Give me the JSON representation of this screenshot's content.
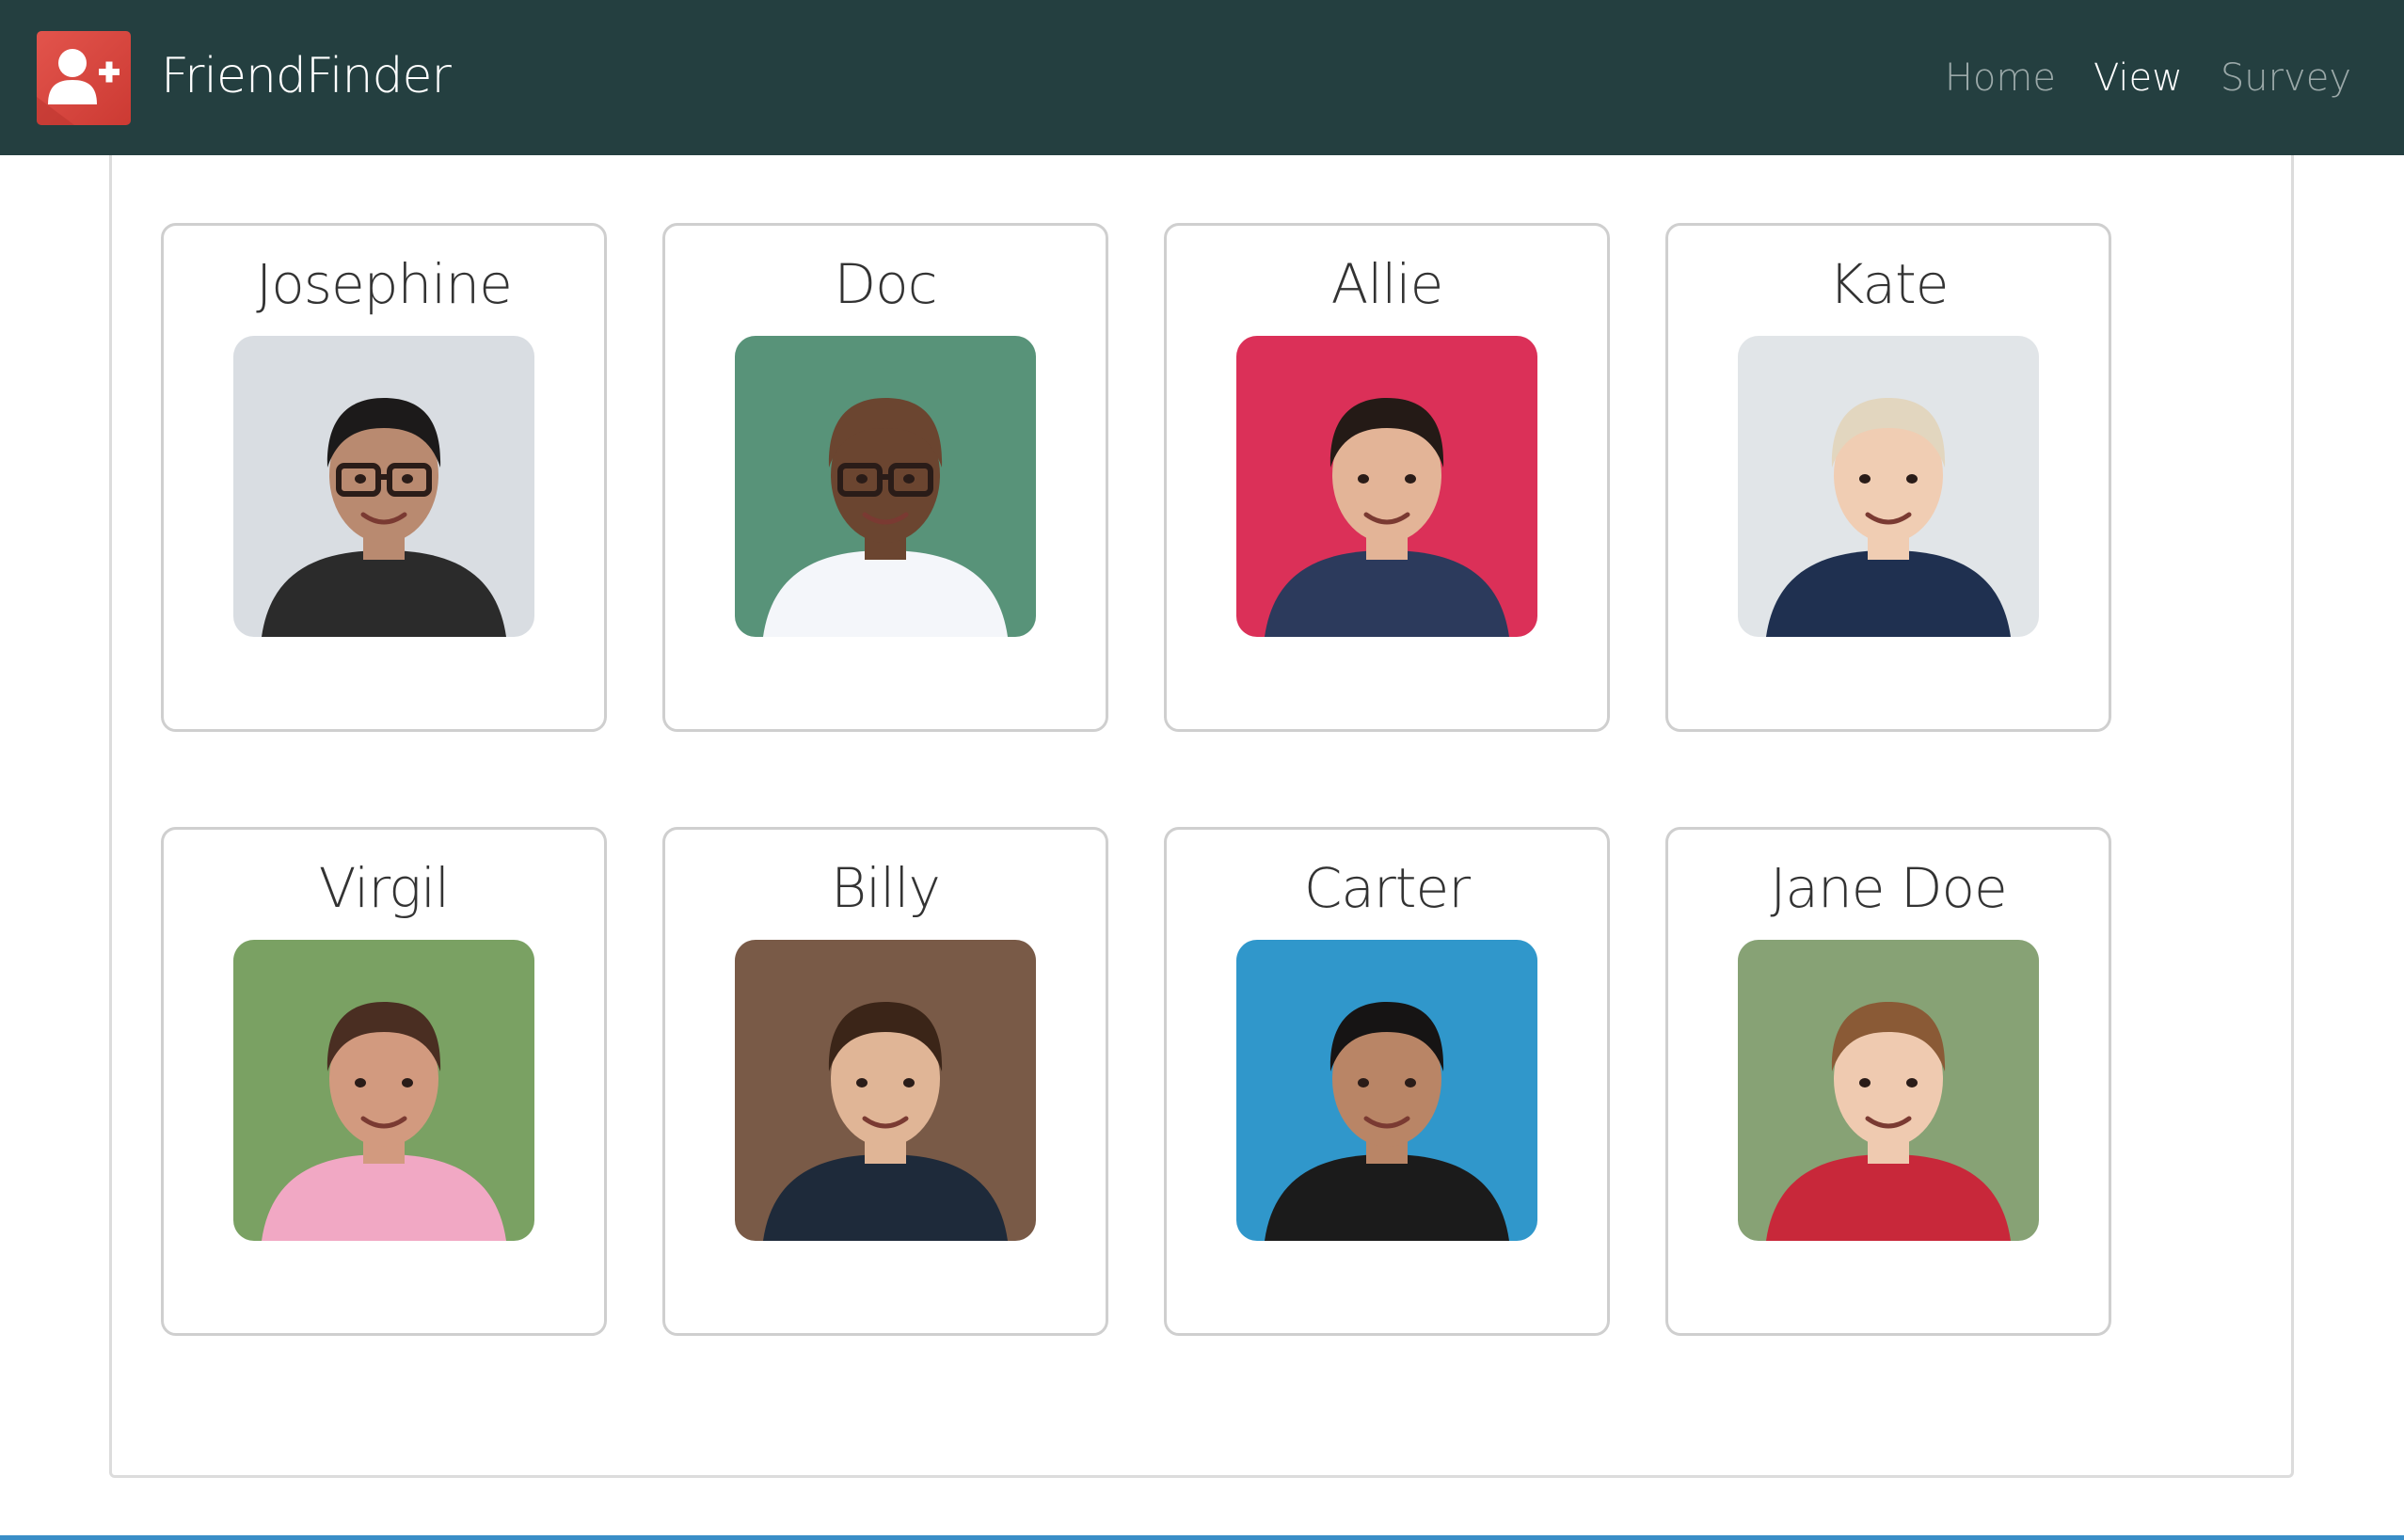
{
  "navbar": {
    "brand": "FriendFinder",
    "links": [
      {
        "label": "Home",
        "active": false
      },
      {
        "label": "View",
        "active": true
      },
      {
        "label": "Survey",
        "active": false
      }
    ]
  },
  "colors": {
    "navbar_bg": "#243f40",
    "logo_red": "#d9443c",
    "nav_active": "#ffffff",
    "nav_inactive": "#9aa8a8"
  },
  "friends": [
    {
      "name": "Josephine",
      "photo": {
        "bg": "#d6dbe0",
        "skin": "#b98a70",
        "hair": "#1c1a1a",
        "shirt": "#2b2b2b",
        "glasses": true
      }
    },
    {
      "name": "Doc",
      "photo": {
        "bg": "#4a8a6e",
        "skin": "#6b4530",
        "hair": "#6b4530",
        "shirt": "#f4f6fa",
        "glasses": true
      }
    },
    {
      "name": "Allie",
      "photo": {
        "bg": "#d81f4a",
        "skin": "#e3b497",
        "hair": "#241a16",
        "shirt": "#2c3a5c",
        "glasses": false
      }
    },
    {
      "name": "Kate",
      "photo": {
        "bg": "#dfe3e6",
        "skin": "#f0cdb3",
        "hair": "#e2d6bf",
        "shirt": "#1f3050",
        "glasses": false
      }
    },
    {
      "name": "Virgil",
      "photo": {
        "bg": "#6f9a56",
        "skin": "#d29a7f",
        "hair": "#4a2e22",
        "shirt": "#f1a8c4",
        "glasses": false
      }
    },
    {
      "name": "Billy",
      "photo": {
        "bg": "#6e4d38",
        "skin": "#e0b596",
        "hair": "#3b2518",
        "shirt": "#1e2a3a",
        "glasses": false
      }
    },
    {
      "name": "Carter",
      "photo": {
        "bg": "#1f8fc7",
        "skin": "#b98566",
        "hair": "#161414",
        "shirt": "#1b1b1b",
        "glasses": false
      }
    },
    {
      "name": "Jane Doe",
      "photo": {
        "bg": "#7d9b6a",
        "skin": "#efcab0",
        "hair": "#8a5a36",
        "shirt": "#c8283a",
        "glasses": false
      }
    }
  ]
}
